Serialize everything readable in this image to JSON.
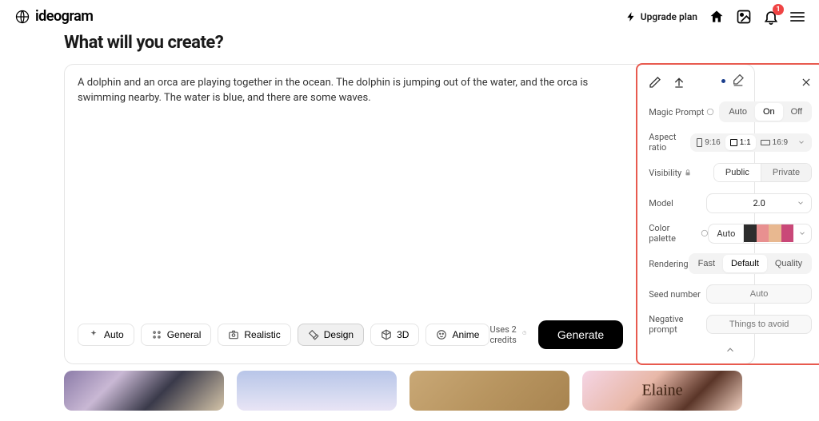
{
  "brand": "ideogram",
  "upgrade_label": "Upgrade plan",
  "notif_count": "1",
  "heading": "What will you create?",
  "prompt": "A dolphin and an orca are playing together in the ocean. The dolphin is jumping out of the water, and the orca is swimming nearby. The water is blue, and there are some waves.",
  "panel": {
    "magic_prompt": {
      "label": "Magic Prompt",
      "opts": [
        "Auto",
        "On",
        "Off"
      ],
      "active": "On"
    },
    "aspect": {
      "label": "Aspect ratio",
      "opts": [
        "9:16",
        "1:1",
        "16:9"
      ],
      "active": "1:1"
    },
    "visibility": {
      "label": "Visibility",
      "opts": [
        "Public",
        "Private"
      ],
      "active": "Public"
    },
    "model": {
      "label": "Model",
      "value": "2.0"
    },
    "palette": {
      "label": "Color palette",
      "auto": "Auto",
      "swatches": [
        "#2d2d2d",
        "#e89090",
        "#e8b890",
        "#c94878"
      ]
    },
    "rendering": {
      "label": "Rendering",
      "opts": [
        "Fast",
        "Default",
        "Quality"
      ],
      "active": "Default"
    },
    "seed": {
      "label": "Seed number",
      "placeholder": "Auto"
    },
    "neg": {
      "label": "Negative prompt",
      "placeholder": "Things to avoid"
    }
  },
  "styles": {
    "items": [
      {
        "key": "auto",
        "label": "Auto"
      },
      {
        "key": "general",
        "label": "General"
      },
      {
        "key": "realistic",
        "label": "Realistic"
      },
      {
        "key": "design",
        "label": "Design"
      },
      {
        "key": "3d",
        "label": "3D"
      },
      {
        "key": "anime",
        "label": "Anime"
      }
    ],
    "active": "design"
  },
  "credits_text": "Uses 2 credits",
  "generate_label": "Generate"
}
